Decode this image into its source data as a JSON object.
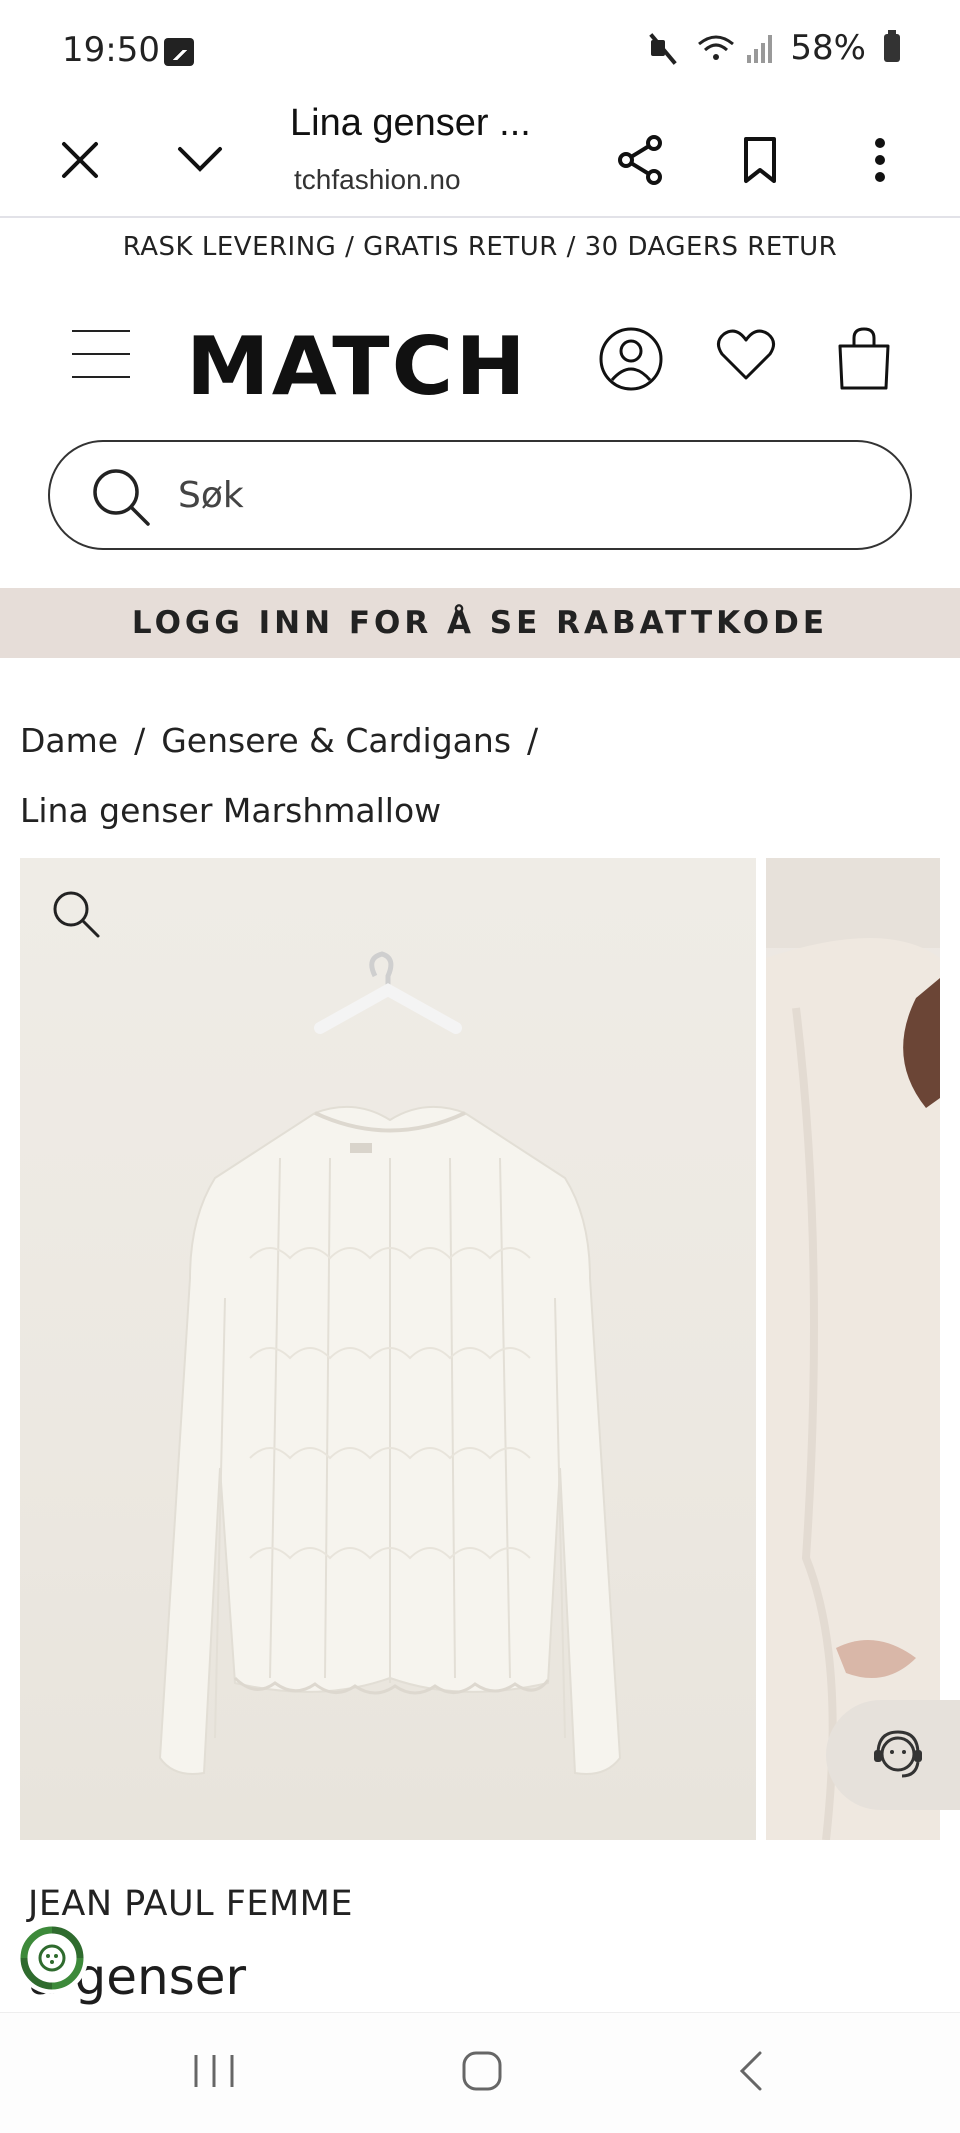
{
  "status_bar": {
    "time": "19:50",
    "battery": "58%",
    "icons": [
      "gallery-icon",
      "mute-icon",
      "wifi-icon",
      "signal-icon",
      "battery-icon"
    ]
  },
  "browser": {
    "title": "Lina genser ...",
    "url": "tchfashion.no",
    "buttons": [
      "close-icon",
      "chevron-down-icon",
      "share-icon",
      "bookmark-icon",
      "more-icon"
    ]
  },
  "promo": {
    "text": "RASK LEVERING / GRATIS RETUR / 30 DAGERS RETUR"
  },
  "header": {
    "logo": "MATCH",
    "icons": [
      "menu-icon",
      "account-icon",
      "heart-icon",
      "bag-icon"
    ]
  },
  "search": {
    "placeholder": "Søk"
  },
  "login_banner": {
    "text": "LOGG INN FOR Å SE RABATTKODE"
  },
  "breadcrumb": {
    "items": [
      "Dame",
      "Gensere & Cardigans",
      "Lina genser Marshmallow"
    ],
    "separator": "/"
  },
  "product": {
    "brand": "JEAN PAUL FEMME",
    "name_partial": "a genser"
  },
  "colors": {
    "banner_bg": "#e6ddd8",
    "image_bg": "#ece8e1",
    "eco_green": "#2f6b2e"
  }
}
